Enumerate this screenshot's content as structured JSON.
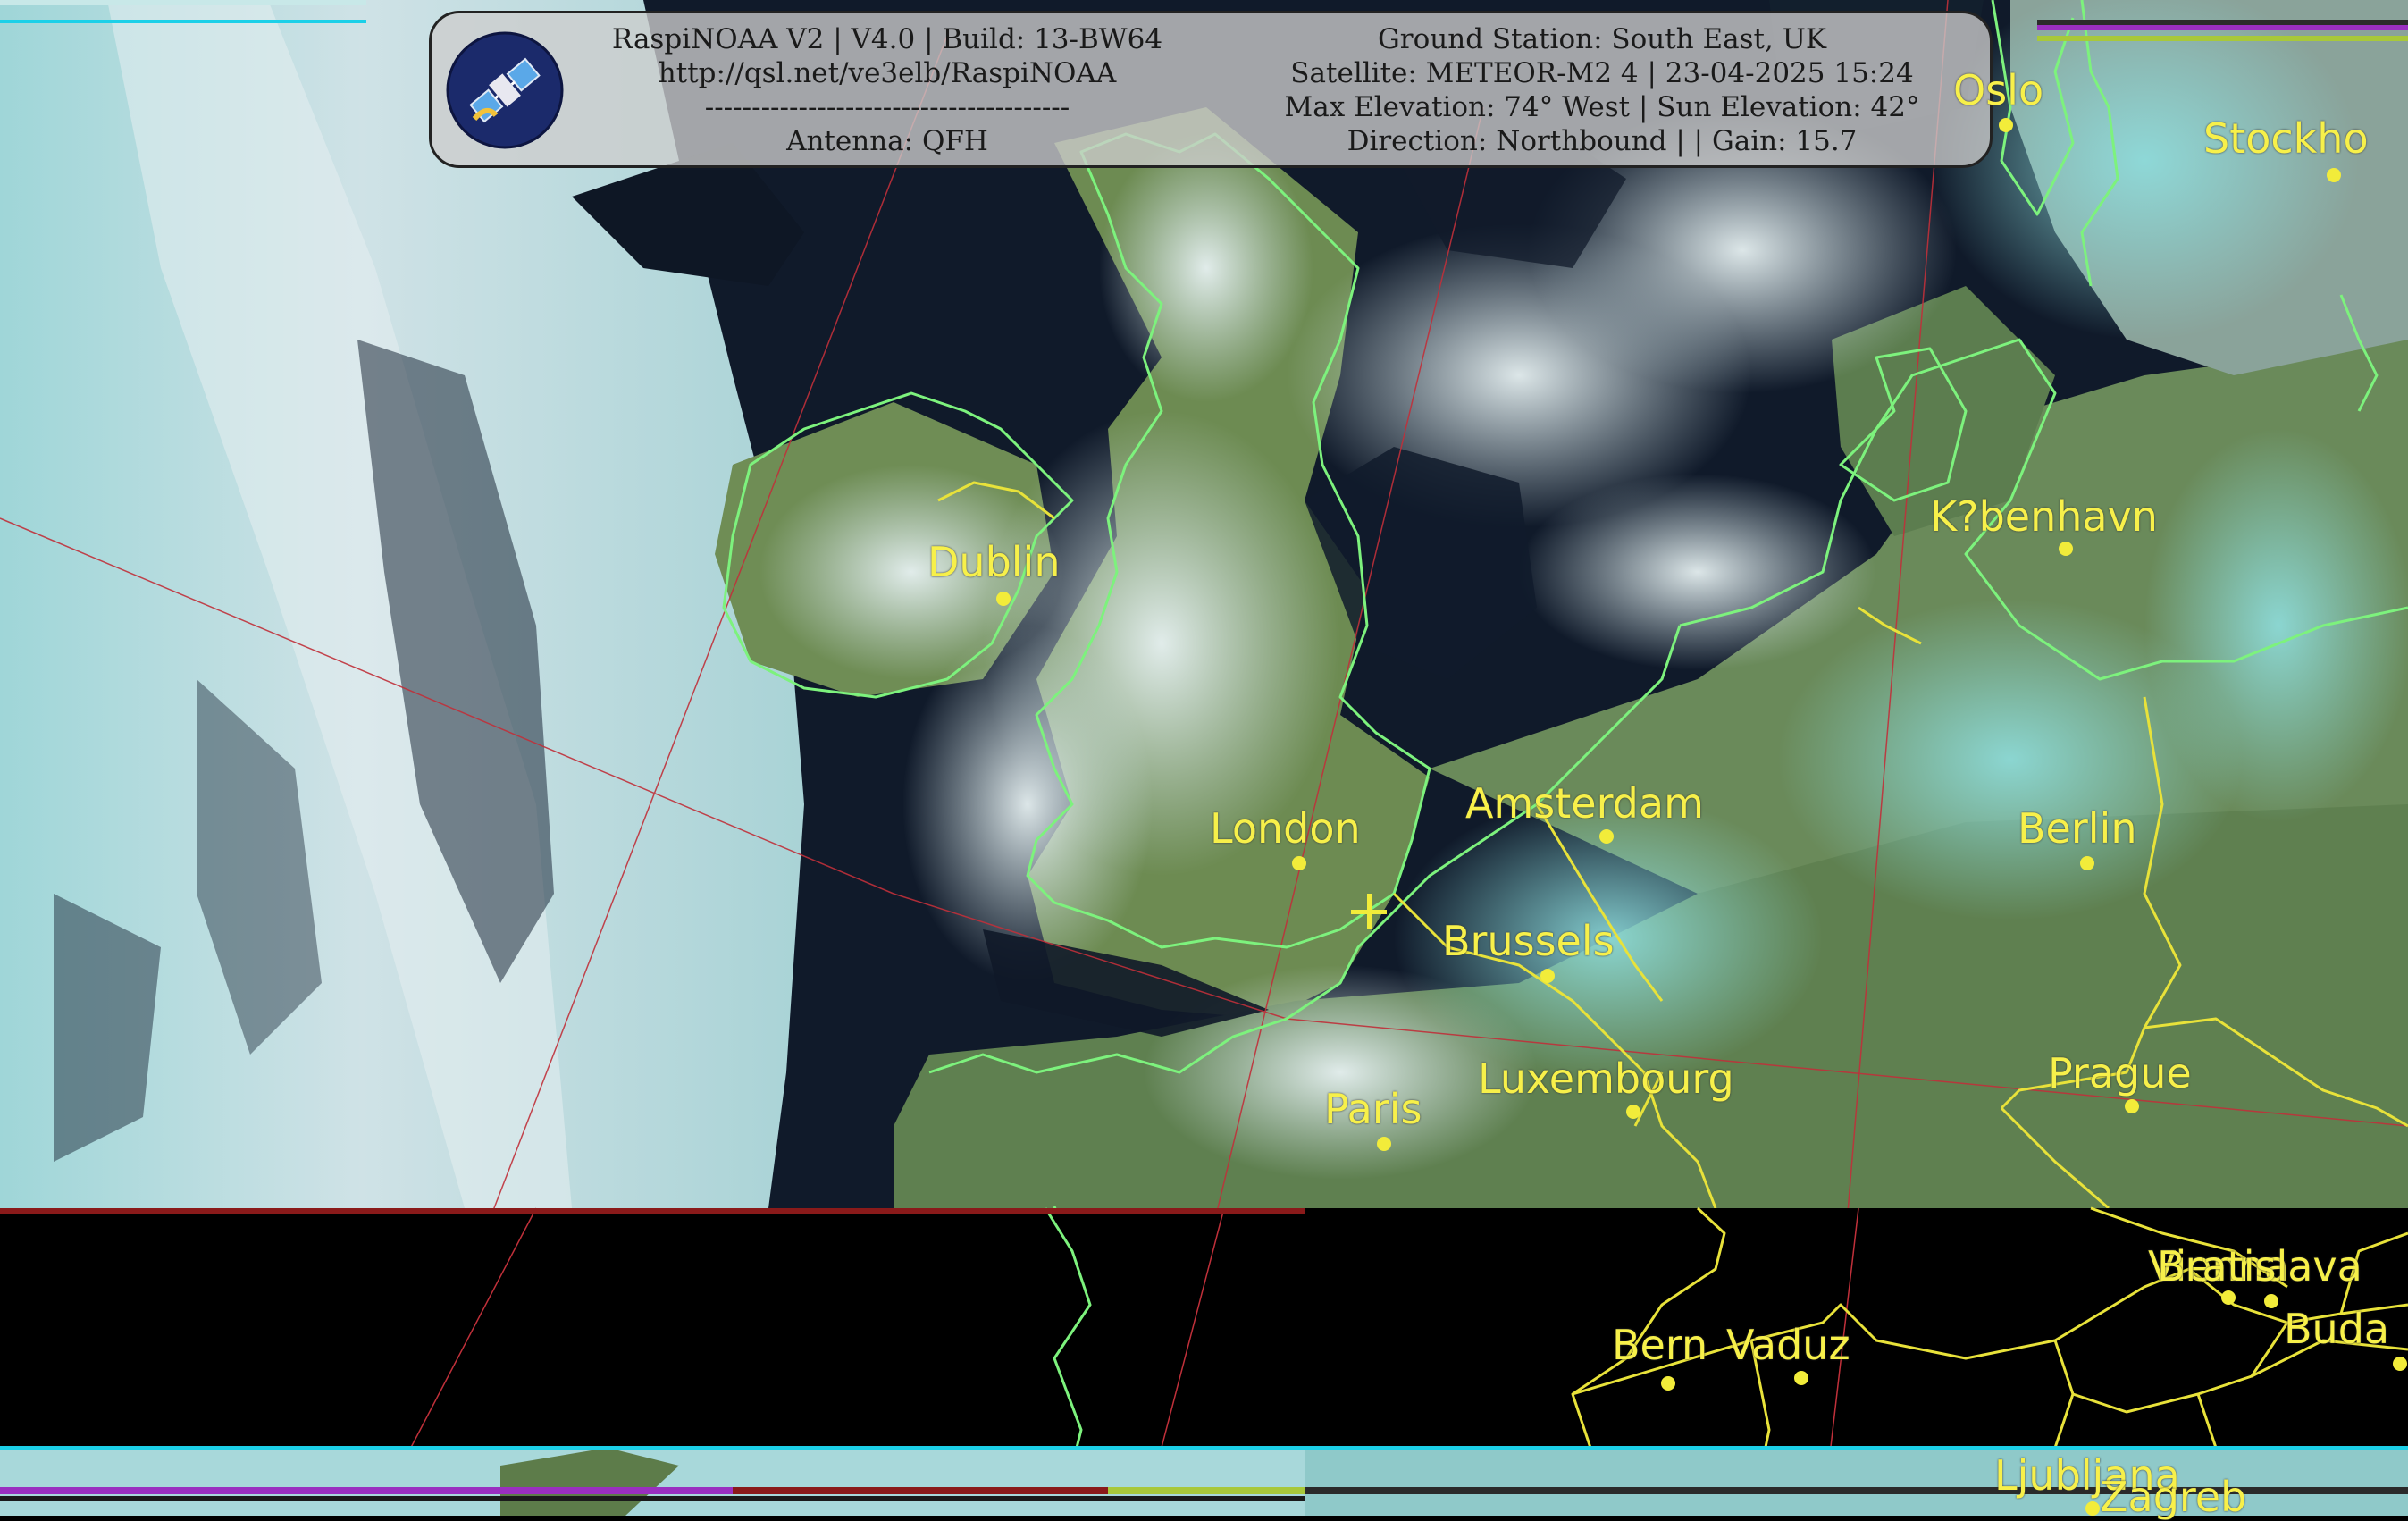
{
  "header": {
    "left_lines": [
      "RaspiNOAA V2 | V4.0 | Build: 13-BW64",
      "http://qsl.net/ve3elb/RaspiNOAA",
      "---------------------------------------",
      "Antenna: QFH"
    ],
    "right_lines": [
      "Ground Station: South East, UK",
      "Satellite: METEOR-M2 4 | 23-04-2025 15:24",
      "Max Elevation: 74° West | Sun Elevation: 42°",
      "Direction: Northbound | | Gain: 15.7"
    ]
  },
  "logo_icon": "satellite-icon",
  "cities": [
    {
      "name": "Oslo"
    },
    {
      "name": "Stockho"
    },
    {
      "name": "K?benhavn"
    },
    {
      "name": "Dublin"
    },
    {
      "name": "Amsterdam"
    },
    {
      "name": "London"
    },
    {
      "name": "Berlin"
    },
    {
      "name": "Brussels"
    },
    {
      "name": "Luxembourg"
    },
    {
      "name": "Prague"
    },
    {
      "name": "Paris"
    },
    {
      "name": "Bern"
    },
    {
      "name": "Vaduz"
    },
    {
      "name": "Vienna"
    },
    {
      "name": "Bratislava"
    },
    {
      "name": "Buda"
    },
    {
      "name": "Ljubljana"
    },
    {
      "name": "Zagreb"
    }
  ],
  "colors": {
    "label": "#f7f04a",
    "coastline": "#7df27d",
    "border": "#e8e23a",
    "grid": "#c0303a",
    "sea": "#0d1626",
    "cloud": "#cfe4e8",
    "land": "#5a7a45"
  }
}
